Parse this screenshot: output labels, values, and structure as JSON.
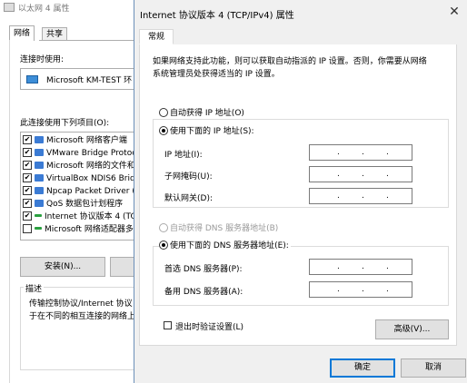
{
  "background_window": {
    "title": "以太网 4 属性",
    "tabs": [
      "网络",
      "共享"
    ],
    "connect_using_label": "连接时使用:",
    "adapter_name": "Microsoft KM-TEST 环",
    "items_label": "此连接使用下列项目(O):",
    "items": [
      {
        "label": "Microsoft 网络客户端",
        "checked": true,
        "icon_color": "#3b7bd4"
      },
      {
        "label": "VMware Bridge Protoco",
        "checked": true,
        "icon_color": "#3b7bd4"
      },
      {
        "label": "Microsoft 网络的文件和",
        "checked": true,
        "icon_color": "#3b7bd4"
      },
      {
        "label": "VirtualBox NDIS6 Bridg",
        "checked": true,
        "icon_color": "#3b7bd4"
      },
      {
        "label": "Npcap Packet Driver (",
        "checked": true,
        "icon_color": "#3b7bd4"
      },
      {
        "label": "QoS 数据包计划程序",
        "checked": true,
        "icon_color": "#3b7bd4"
      },
      {
        "label": "Internet 协议版本 4 (TC",
        "checked": true,
        "icon_color": "#2aa040"
      },
      {
        "label": "Microsoft 网络适配器多",
        "checked": false,
        "icon_color": "#2aa040"
      }
    ],
    "install_button": "安装(N)...",
    "description_group": "描述",
    "description_line1": "传输控制协议/Internet 协议",
    "description_line2": "于在不同的相互连接的网络上"
  },
  "dialog": {
    "title": "Internet 协议版本 4 (TCP/IPv4) 属性",
    "close_glyph": "✕",
    "tab": "常规",
    "description_line1": "如果网络支持此功能，则可以获取自动指派的 IP 设置。否则，你需要从网络",
    "description_line2": "系统管理员处获得适当的 IP 设置。",
    "ip": {
      "auto_label": "自动获得 IP 地址(O)",
      "manual_label": "使用下面的 IP 地址(S):",
      "ip_address_label": "IP 地址(I):",
      "subnet_label": "子网掩码(U):",
      "gateway_label": "默认网关(D):"
    },
    "dns": {
      "auto_label": "自动获得 DNS 服务器地址(B)",
      "manual_label": "使用下面的 DNS 服务器地址(E):",
      "preferred_label": "首选 DNS 服务器(P):",
      "alternate_label": "备用 DNS 服务器(A):"
    },
    "ip_dot": ".",
    "validate_on_exit_label": "退出时验证设置(L)",
    "advanced_button": "高级(V)...",
    "ok_button": "确定",
    "cancel_button": "取消"
  }
}
